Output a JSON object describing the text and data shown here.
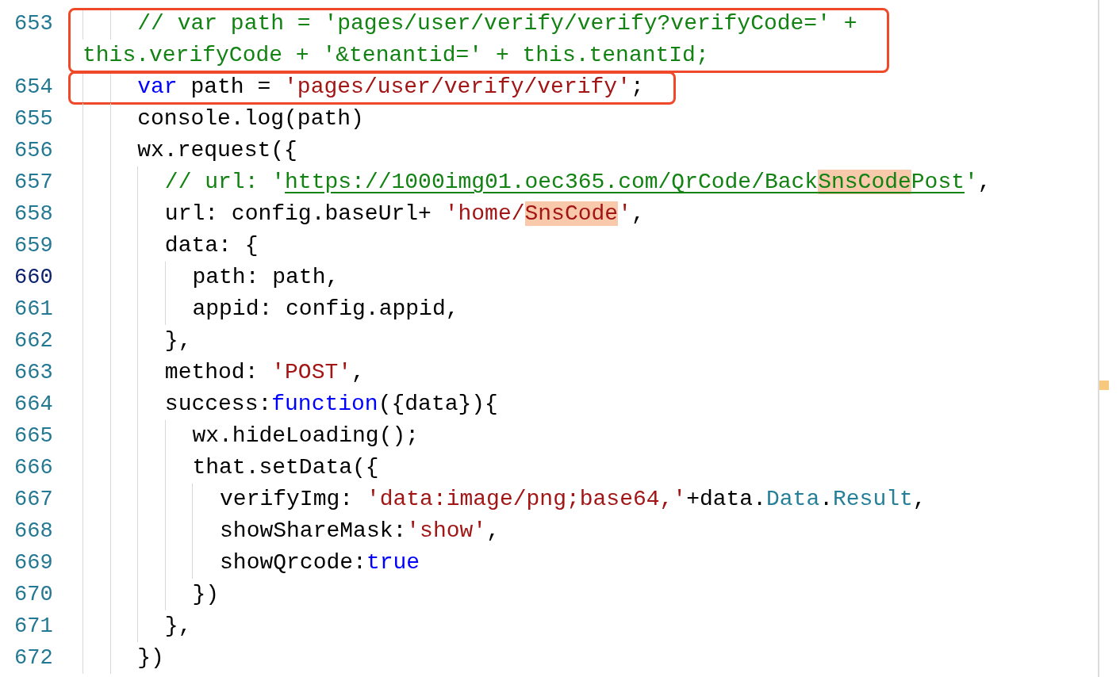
{
  "editor": {
    "lines": [
      {
        "number": "653",
        "current": false,
        "annotated": true,
        "rows": [
          [
            {
              "kind": "indent",
              "text": "    "
            },
            {
              "kind": "comment",
              "text": "// var path = 'pages/user/verify/verify?verifyCode=' +"
            }
          ],
          [
            {
              "kind": "comment",
              "text": "this.verifyCode + '&tenantid=' + this.tenantId;"
            }
          ]
        ]
      },
      {
        "number": "654",
        "current": false,
        "annotated": true,
        "rows": [
          [
            {
              "kind": "indent",
              "text": "    "
            },
            {
              "kind": "keyword",
              "text": "var"
            },
            {
              "kind": "plain",
              "text": " path = "
            },
            {
              "kind": "string",
              "text": "'pages/user/verify/verify'"
            },
            {
              "kind": "plain",
              "text": ";"
            }
          ]
        ]
      },
      {
        "number": "655",
        "current": false,
        "annotated": false,
        "rows": [
          [
            {
              "kind": "indent",
              "text": "    "
            },
            {
              "kind": "plain",
              "text": "console.log(path)"
            }
          ]
        ]
      },
      {
        "number": "656",
        "current": false,
        "annotated": false,
        "rows": [
          [
            {
              "kind": "indent",
              "text": "    "
            },
            {
              "kind": "plain",
              "text": "wx.request({"
            }
          ]
        ]
      },
      {
        "number": "657",
        "current": false,
        "annotated": false,
        "rows": [
          [
            {
              "kind": "indent",
              "text": "      "
            },
            {
              "kind": "comment",
              "text": "// url: '"
            },
            {
              "kind": "comment",
              "link": true,
              "text": "https://1000img01.oec365.com/QrCode/Back"
            },
            {
              "kind": "comment",
              "link": true,
              "highlight": true,
              "text": "SnsCode"
            },
            {
              "kind": "comment",
              "link": true,
              "text": "Post"
            },
            {
              "kind": "comment",
              "text": "'"
            },
            {
              "kind": "plain",
              "text": ","
            }
          ]
        ]
      },
      {
        "number": "658",
        "current": false,
        "annotated": false,
        "rows": [
          [
            {
              "kind": "indent",
              "text": "      "
            },
            {
              "kind": "plain",
              "text": "url: config.baseUrl+ "
            },
            {
              "kind": "string",
              "text": "'home/"
            },
            {
              "kind": "string",
              "highlight": true,
              "text": "SnsCode"
            },
            {
              "kind": "string",
              "text": "'"
            },
            {
              "kind": "plain",
              "text": ","
            }
          ]
        ]
      },
      {
        "number": "659",
        "current": false,
        "annotated": false,
        "rows": [
          [
            {
              "kind": "indent",
              "text": "      "
            },
            {
              "kind": "plain",
              "text": "data: {"
            }
          ]
        ]
      },
      {
        "number": "660",
        "current": true,
        "annotated": false,
        "rows": [
          [
            {
              "kind": "indent",
              "text": "        "
            },
            {
              "kind": "plain",
              "text": "path: path,"
            }
          ]
        ]
      },
      {
        "number": "661",
        "current": false,
        "annotated": false,
        "rows": [
          [
            {
              "kind": "indent",
              "text": "        "
            },
            {
              "kind": "plain",
              "text": "appid: config.appid,"
            }
          ]
        ]
      },
      {
        "number": "662",
        "current": false,
        "annotated": false,
        "rows": [
          [
            {
              "kind": "indent",
              "text": "      "
            },
            {
              "kind": "plain",
              "text": "},"
            }
          ]
        ]
      },
      {
        "number": "663",
        "current": false,
        "annotated": false,
        "rows": [
          [
            {
              "kind": "indent",
              "text": "      "
            },
            {
              "kind": "plain",
              "text": "method: "
            },
            {
              "kind": "string",
              "text": "'POST'"
            },
            {
              "kind": "plain",
              "text": ","
            }
          ]
        ]
      },
      {
        "number": "664",
        "current": false,
        "annotated": false,
        "rows": [
          [
            {
              "kind": "indent",
              "text": "      "
            },
            {
              "kind": "plain",
              "text": "success:"
            },
            {
              "kind": "keyword",
              "text": "function"
            },
            {
              "kind": "plain",
              "text": "({data}){"
            }
          ]
        ]
      },
      {
        "number": "665",
        "current": false,
        "annotated": false,
        "rows": [
          [
            {
              "kind": "indent",
              "text": "        "
            },
            {
              "kind": "plain",
              "text": "wx.hideLoading();"
            }
          ]
        ]
      },
      {
        "number": "666",
        "current": false,
        "annotated": false,
        "rows": [
          [
            {
              "kind": "indent",
              "text": "        "
            },
            {
              "kind": "plain",
              "text": "that.setData({"
            }
          ]
        ]
      },
      {
        "number": "667",
        "current": false,
        "annotated": false,
        "rows": [
          [
            {
              "kind": "indent",
              "text": "          "
            },
            {
              "kind": "plain",
              "text": "verifyImg: "
            },
            {
              "kind": "string",
              "text": "'data:image/png;base64,'"
            },
            {
              "kind": "plain",
              "text": "+data."
            },
            {
              "kind": "property",
              "text": "Data"
            },
            {
              "kind": "plain",
              "text": "."
            },
            {
              "kind": "property",
              "text": "Result"
            },
            {
              "kind": "plain",
              "text": ","
            }
          ]
        ]
      },
      {
        "number": "668",
        "current": false,
        "annotated": false,
        "rows": [
          [
            {
              "kind": "indent",
              "text": "          "
            },
            {
              "kind": "plain",
              "text": "showShareMask:"
            },
            {
              "kind": "string",
              "text": "'show'"
            },
            {
              "kind": "plain",
              "text": ","
            }
          ]
        ]
      },
      {
        "number": "669",
        "current": false,
        "annotated": false,
        "rows": [
          [
            {
              "kind": "indent",
              "text": "          "
            },
            {
              "kind": "plain",
              "text": "showQrcode:"
            },
            {
              "kind": "keyword",
              "text": "true"
            }
          ]
        ]
      },
      {
        "number": "670",
        "current": false,
        "annotated": false,
        "rows": [
          [
            {
              "kind": "indent",
              "text": "        "
            },
            {
              "kind": "plain",
              "text": "})"
            }
          ]
        ]
      },
      {
        "number": "671",
        "current": false,
        "annotated": false,
        "rows": [
          [
            {
              "kind": "indent",
              "text": "      "
            },
            {
              "kind": "plain",
              "text": "},"
            }
          ]
        ]
      },
      {
        "number": "672",
        "current": false,
        "annotated": false,
        "rows": [
          [
            {
              "kind": "indent",
              "text": "    "
            },
            {
              "kind": "plain",
              "text": "})"
            }
          ]
        ]
      }
    ]
  }
}
